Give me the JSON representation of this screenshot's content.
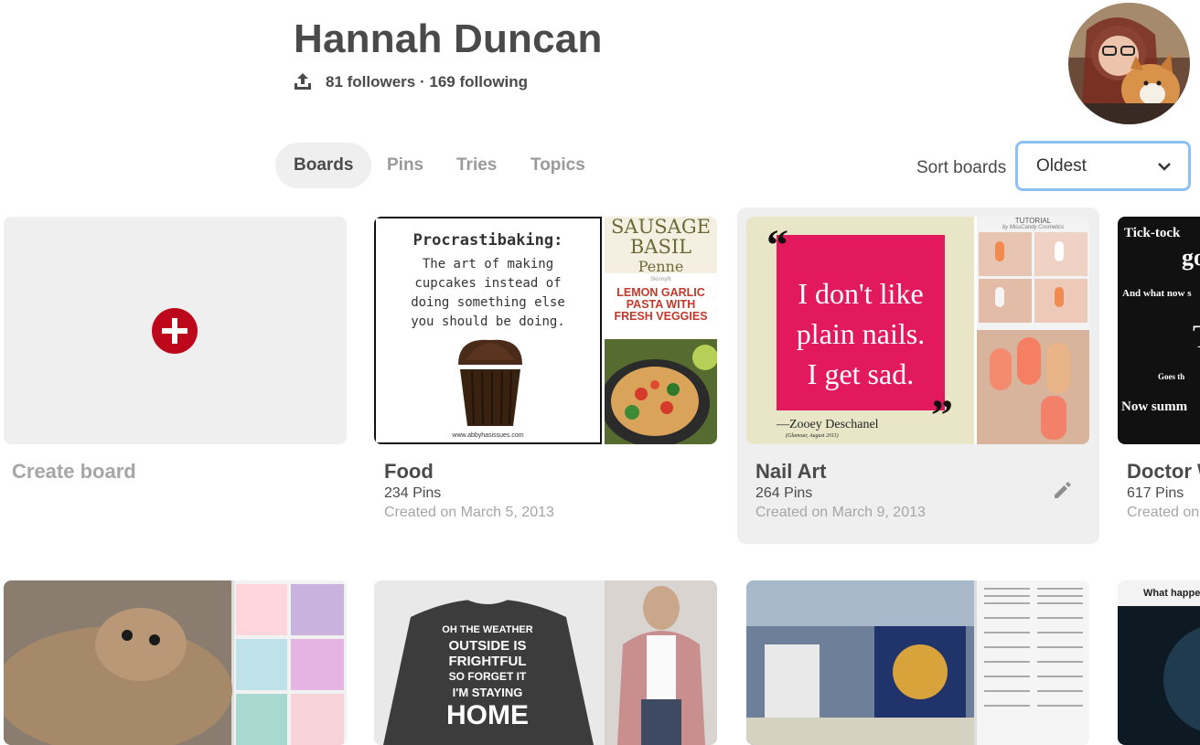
{
  "profile": {
    "name": "Hannah Duncan",
    "stats": "81 followers · 169 following"
  },
  "tabs": [
    {
      "label": "Boards"
    },
    {
      "label": "Pins"
    },
    {
      "label": "Tries"
    },
    {
      "label": "Topics"
    }
  ],
  "sort": {
    "label": "Sort boards",
    "value": "Oldest"
  },
  "create_board": {
    "label": "Create board"
  },
  "boards": [
    {
      "title": "Food",
      "pins": "234 Pins",
      "created": "Created on March 5, 2013",
      "cover_text": {
        "heading": "Procrastibaking:",
        "body": [
          "The art of making",
          "cupcakes instead of",
          "doing something else",
          "you should be doing."
        ],
        "footer": "www.abbyhasissues.com"
      },
      "side_top": [
        "SAUSAGE",
        "BASIL",
        "Penne"
      ],
      "side_mid": {
        "small": "Skinnyfit",
        "lines": [
          "LEMON GARLIC",
          "PASTA WITH",
          "FRESH VEGGIES"
        ]
      }
    },
    {
      "title": "Nail Art",
      "pins": "264 Pins",
      "created": "Created on March 9, 2013",
      "cover_text": {
        "lines": [
          "I don't like",
          "plain nails.",
          "I get sad."
        ],
        "attribution": "—Zooey Deschanel",
        "source": "(Glamour, August 2011)"
      },
      "side_top": {
        "title": "TUTORIAL",
        "subtitle": "by MissCandy Cosmetics"
      }
    },
    {
      "title": "Doctor W",
      "pins": "617 Pins",
      "created": "Created on",
      "cover_text": [
        "Tick-tock",
        "go",
        "And what now s",
        "T",
        "Goes th",
        "Now summ"
      ]
    }
  ],
  "row2": {
    "sweatshirt_text": [
      "OH THE WEATHER",
      "OUTSIDE IS",
      "FRIGHTFUL",
      "SO FORGET IT",
      "I'M STAYING",
      "HOME"
    ],
    "last_card_text": "What happens"
  },
  "colors": {
    "accent_red": "#bd081c",
    "focus_ring": "#8ec1f3",
    "tab_bg": "#efefef"
  }
}
